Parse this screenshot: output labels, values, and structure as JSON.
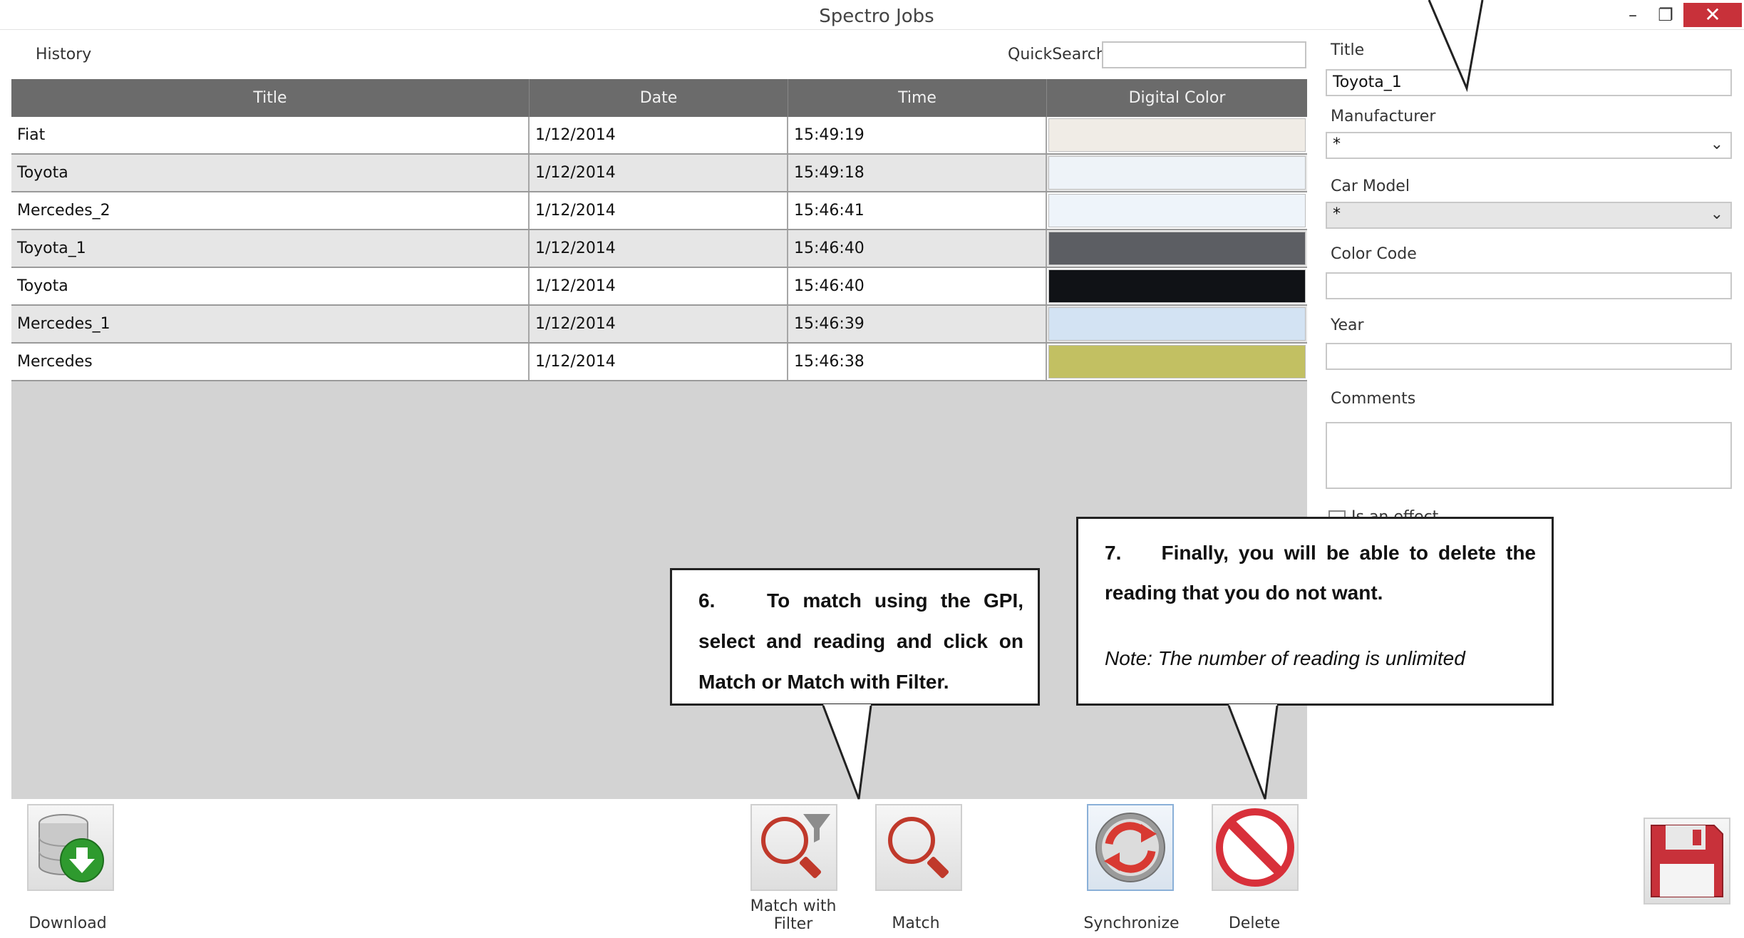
{
  "window": {
    "title": "Spectro Jobs",
    "minimize_glyph": "–",
    "maximize_glyph": "❐",
    "close_glyph": "✕"
  },
  "history_label": "History",
  "quicksearch": {
    "label": "QuickSearch",
    "value": ""
  },
  "table": {
    "columns": [
      "Title",
      "Date",
      "Time",
      "Digital Color"
    ],
    "rows": [
      {
        "title": "Fiat",
        "date": "1/12/2014",
        "time": "15:49:19",
        "color": "#f0ece6"
      },
      {
        "title": "Toyota",
        "date": "1/12/2014",
        "time": "15:49:18",
        "color": "#eef3f8"
      },
      {
        "title": "Mercedes_2",
        "date": "1/12/2014",
        "time": "15:46:41",
        "color": "#eef4fa"
      },
      {
        "title": "Toyota_1",
        "date": "1/12/2014",
        "time": "15:46:40",
        "color": "#5c5e63"
      },
      {
        "title": "Toyota",
        "date": "1/12/2014",
        "time": "15:46:40",
        "color": "#101216"
      },
      {
        "title": "Mercedes_1",
        "date": "1/12/2014",
        "time": "15:46:39",
        "color": "#d3e3f3"
      },
      {
        "title": "Mercedes",
        "date": "1/12/2014",
        "time": "15:46:38",
        "color": "#c2c062"
      }
    ]
  },
  "form": {
    "title_label": "Title",
    "title_value": "Toyota_1",
    "manufacturer_label": "Manufacturer",
    "manufacturer_value": "*",
    "car_model_label": "Car Model",
    "car_model_value": "*",
    "color_code_label": "Color Code",
    "color_code_value": "",
    "year_label": "Year",
    "year_value": "",
    "comments_label": "Comments",
    "comments_value": "",
    "effect_label": "Is an effect"
  },
  "toolbar": {
    "download": "Download",
    "match_with_filter_line1": "Match with",
    "match_with_filter_line2": "Filter",
    "match": "Match",
    "synchronize": "Synchronize",
    "delete": "Delete"
  },
  "callouts": {
    "step6": "6.    To match using the GPI, select and reading and click on Match or Match with Filter.",
    "step7": "7.    Finally, you will be able to delete the reading that you do not want.",
    "step7_note": "Note: The number of reading is unlimited"
  },
  "colors": {
    "header_bg": "#6b6b6b",
    "grid_bg": "#d3d3d3",
    "close_button": "#c8313a",
    "download_icon": "#2e9a2e",
    "match_icon": "#c0392b",
    "sync_icon": "#d83a32",
    "delete_icon": "#d8303a",
    "save_icon": "#c8313a"
  },
  "icons": {
    "download": "database-download-icon",
    "match_with_filter": "magnifier-filter-icon",
    "match": "magnifier-icon",
    "synchronize": "sync-arrows-icon",
    "delete": "no-entry-icon",
    "save": "floppy-disk-icon"
  }
}
